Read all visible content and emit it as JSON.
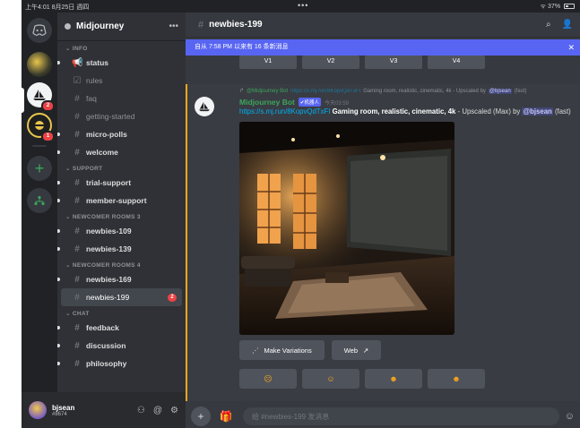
{
  "status_bar": {
    "time": "上午4:01  8月25日 週四",
    "battery": "37%"
  },
  "servers": {
    "badge_1": "2",
    "badge_2": "1"
  },
  "guild": {
    "name": "Midjourney"
  },
  "sidebar": {
    "categories": [
      "INFO",
      "SUPPORT",
      "NEWCOMER ROOMS 3",
      "NEWCOMER ROOMS 4",
      "CHAT"
    ],
    "channels": [
      {
        "name": "status"
      },
      {
        "name": "rules"
      },
      {
        "name": "faq"
      },
      {
        "name": "getting-started"
      },
      {
        "name": "micro-polls"
      },
      {
        "name": "welcome"
      },
      {
        "name": "trial-support"
      },
      {
        "name": "member-support"
      },
      {
        "name": "newbies-109"
      },
      {
        "name": "newbies-139"
      },
      {
        "name": "newbies-169"
      },
      {
        "name": "newbies-199",
        "badge": "2"
      },
      {
        "name": "feedback"
      },
      {
        "name": "discussion"
      },
      {
        "name": "philosophy"
      }
    ]
  },
  "user": {
    "name": "bjsean",
    "tag": "#8674"
  },
  "chat": {
    "channel_title": "newbies-199",
    "new_messages_bar": "自从 7:58 PM 以来有 16 条新消息",
    "variation_buttons": [
      "V1",
      "V2",
      "V3",
      "V4"
    ],
    "message": {
      "reply_author": "@Midjourney Bot",
      "reply_link": "https://s.mj.run/8KopvQdTxFI",
      "reply_text": "Gaming room, realistic, cinematic, 4k - Upscaled by",
      "reply_mention": "@bjsean",
      "reply_suffix": "(fast)",
      "author": "Midjourney Bot",
      "bot_tag": "✔机器人",
      "timestamp": "今天03:59",
      "link": "https://s.mj.run/8KopvQdTxFI",
      "prompt": "Gaming room, realistic, cinematic, 4k",
      "suffix": " - Upscaled (Max) by ",
      "mention": "@bjsean",
      "speed": " (fast)"
    },
    "actions": {
      "make_variations": "Make Variations",
      "web": "Web"
    },
    "composer_placeholder": "给 #newbies-199 发消息"
  },
  "colors": {
    "accent": "#5865f2",
    "bot_name": "#3ba55d",
    "highlight_border": "#faa61a",
    "badge": "#ed4245"
  }
}
